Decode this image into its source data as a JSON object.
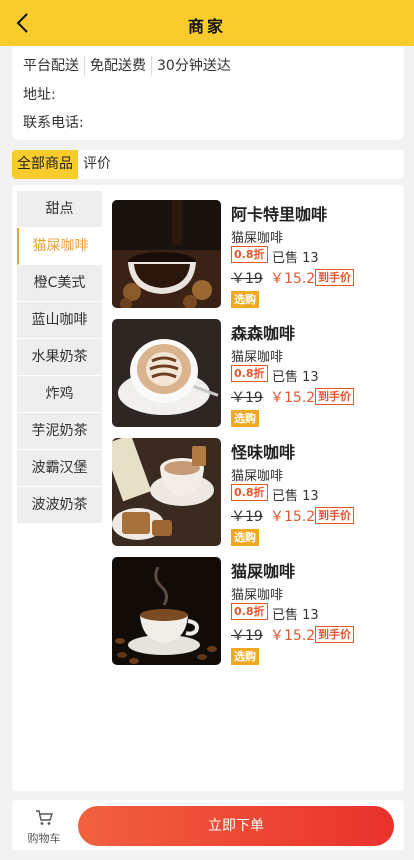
{
  "header": {
    "title": "商家",
    "back_icon": "chevron-left-icon"
  },
  "info": {
    "tags": [
      "平台配送",
      "免配送费",
      "30分钟送达"
    ],
    "address_label": "地址:",
    "phone_label": "联系电话:"
  },
  "tabs": [
    {
      "label": "全部商品",
      "active": true
    },
    {
      "label": "评价",
      "active": false
    }
  ],
  "categories": [
    {
      "label": "甜点",
      "active": false
    },
    {
      "label": "猫屎咖啡",
      "active": true
    },
    {
      "label": "橙C美式",
      "active": false
    },
    {
      "label": "蓝山咖啡",
      "active": false
    },
    {
      "label": "水果奶茶",
      "active": false
    },
    {
      "label": "炸鸡",
      "active": false
    },
    {
      "label": "芋泥奶茶",
      "active": false
    },
    {
      "label": "波霸汉堡",
      "active": false
    },
    {
      "label": "波波奶茶",
      "active": false
    }
  ],
  "products": [
    {
      "name": "阿卡特里咖啡",
      "desc": "猫屎咖啡",
      "discount": "0.8折",
      "sold": "已售 13",
      "old_price": "￥19",
      "new_price": "￥15.2",
      "hand_label": "到手价",
      "select_label": "选购",
      "image": "coffee-pour-photo"
    },
    {
      "name": "森森咖啡",
      "desc": "猫屎咖啡",
      "discount": "0.8折",
      "sold": "已售 13",
      "old_price": "￥19",
      "new_price": "￥15.2",
      "hand_label": "到手价",
      "select_label": "选购",
      "image": "latte-art-photo"
    },
    {
      "name": "怪味咖啡",
      "desc": "猫屎咖啡",
      "discount": "0.8折",
      "sold": "已售 13",
      "old_price": "￥19",
      "new_price": "￥15.2",
      "hand_label": "到手价",
      "select_label": "选购",
      "image": "coffee-biscuit-photo"
    },
    {
      "name": "猫屎咖啡",
      "desc": "猫屎咖啡",
      "discount": "0.8折",
      "sold": "已售 13",
      "old_price": "￥19",
      "new_price": "￥15.2",
      "hand_label": "到手价",
      "select_label": "选购",
      "image": "coffee-beans-photo"
    }
  ],
  "footer": {
    "cart_label": "购物车",
    "cart_icon": "cart-icon",
    "order_label": "立即下单"
  },
  "colors": {
    "accent": "#f7cc2c",
    "category_active": "#e8a23a",
    "price": "#e4572e",
    "select_bg": "#f0a722",
    "order_start": "#f2613f",
    "order_end": "#e8322c"
  }
}
